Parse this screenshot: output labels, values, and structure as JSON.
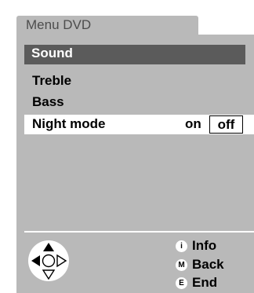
{
  "header": {
    "title": "Menu DVD"
  },
  "section": {
    "title": "Sound"
  },
  "menu": {
    "items": [
      {
        "label": "Treble"
      },
      {
        "label": "Bass"
      },
      {
        "label": "Night mode"
      }
    ],
    "selected_item": "Night mode",
    "night_mode": {
      "options": [
        "on",
        "off"
      ],
      "current": "off"
    }
  },
  "legend": {
    "info": {
      "key": "i",
      "label": "Info"
    },
    "back": {
      "key": "M",
      "label": "Back"
    },
    "end": {
      "key": "E",
      "label": "End"
    }
  },
  "navigation": {
    "icon": "directional-pad-icon"
  },
  "colors": {
    "panel": "#b9b9b9",
    "section_bar": "#5b5b5b",
    "highlight": "#ffffff",
    "text": "#000000",
    "header_text": "#4d4d4d"
  }
}
